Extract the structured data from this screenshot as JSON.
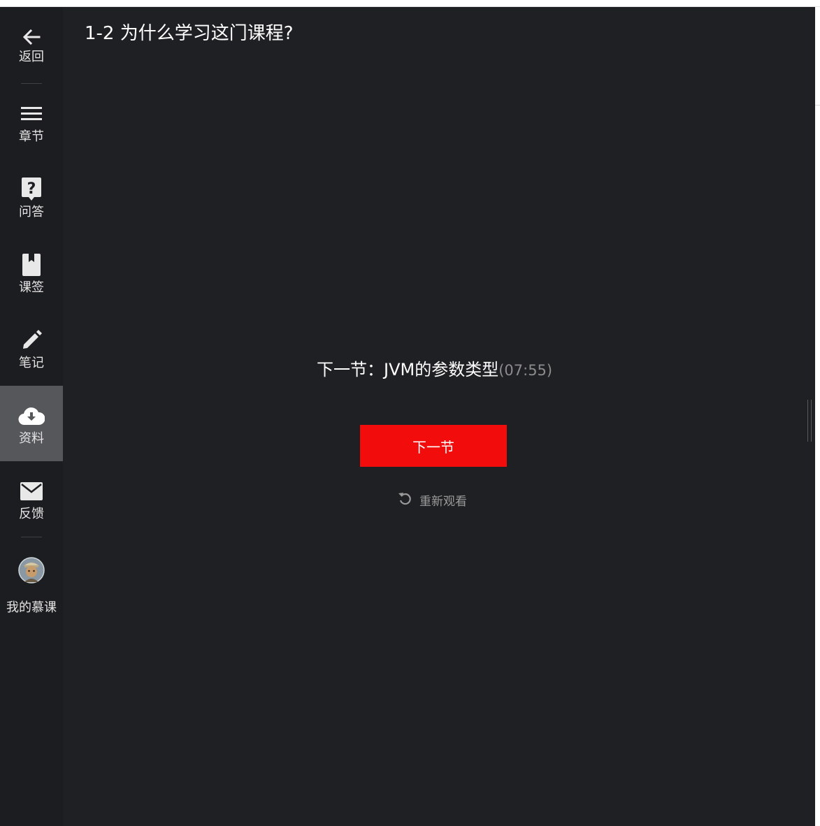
{
  "sidebar": {
    "items": [
      {
        "label": "返回",
        "icon": "arrow-left-icon"
      },
      {
        "label": "章节",
        "icon": "menu-icon"
      },
      {
        "label": "问答",
        "icon": "question-icon"
      },
      {
        "label": "课签",
        "icon": "bookmark-icon"
      },
      {
        "label": "笔记",
        "icon": "pencil-icon"
      },
      {
        "label": "资料",
        "icon": "cloud-download-icon",
        "active": true
      },
      {
        "label": "反馈",
        "icon": "mail-icon"
      },
      {
        "label": "我的慕课",
        "icon": "avatar"
      }
    ]
  },
  "video": {
    "title": "1-2 为什么学习这门课程?"
  },
  "end_screen": {
    "next_prefix": "下一节：",
    "next_title": "JVM的参数类型",
    "next_duration": "(07:55)",
    "next_button": "下一节",
    "replay_label": "重新观看"
  },
  "colors": {
    "background": "#1f2023",
    "sidebar": "#1c1d20",
    "active_item": "#55575b",
    "accent": "#f20c0c",
    "muted_text": "#9a9a9a"
  }
}
